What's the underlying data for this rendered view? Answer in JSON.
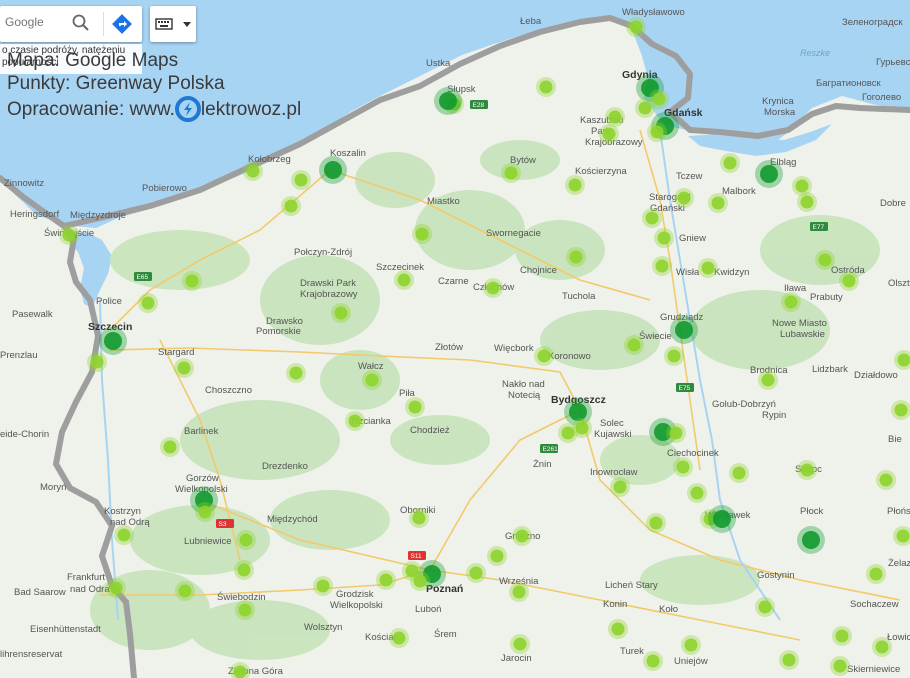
{
  "search": {
    "placeholder": "Google"
  },
  "traffic_note": "o czasie podróży, natężeniu popularności",
  "caption": {
    "line1": "Mapa: Google Maps",
    "line2": "Punkty: Greenway Polska",
    "line3_prefix": "Opracowanie: www.",
    "line3_suffix": "lektrowoz.pl"
  },
  "colors": {
    "sea": "#a8d4f4",
    "land": "#eef2ea",
    "forest": "#c8e4bc",
    "border": "#9e9e9e",
    "point_light": "#8ed42e",
    "point_dark": "#119a2e",
    "logo": "#1f78d1"
  },
  "water_labels": [
    {
      "id": "reszke",
      "text": "Reszke"
    }
  ],
  "roads": [
    {
      "id": "e28",
      "text": "E28"
    },
    {
      "id": "e65",
      "text": "E65"
    },
    {
      "id": "e261",
      "text": "E261"
    },
    {
      "id": "e75",
      "text": "E75"
    },
    {
      "id": "s11",
      "text": "S11"
    },
    {
      "id": "s3",
      "text": "S3"
    },
    {
      "id": "e77",
      "text": "E77"
    }
  ],
  "cities": [
    {
      "id": "ustka",
      "text": "Ustka"
    },
    {
      "id": "leba",
      "text": "Łeba"
    },
    {
      "id": "wladyslawowo",
      "text": "Władysławowo"
    },
    {
      "id": "slupsk",
      "text": "Słupsk"
    },
    {
      "id": "gdynia",
      "text": "Gdynia"
    },
    {
      "id": "gdansk",
      "text": "Gdańsk"
    },
    {
      "id": "koszalin",
      "text": "Koszalin"
    },
    {
      "id": "kolobrzeg",
      "text": "Kołobrzeg"
    },
    {
      "id": "bytow",
      "text": "Bytów"
    },
    {
      "id": "koscierzyna",
      "text": "Kościerzyna"
    },
    {
      "id": "kaszubski",
      "text": "Kaszubski"
    },
    {
      "id": "park",
      "text": "Park"
    },
    {
      "id": "krajobrazowy",
      "text": "Krajobrazowy"
    },
    {
      "id": "elblag",
      "text": "Elbląg"
    },
    {
      "id": "tczew",
      "text": "Tczew"
    },
    {
      "id": "malbork",
      "text": "Malbork"
    },
    {
      "id": "starogard",
      "text": "Starogard"
    },
    {
      "id": "gdanski",
      "text": "Gdański"
    },
    {
      "id": "miastko",
      "text": "Miastko"
    },
    {
      "id": "swiecie",
      "text": "Świecie"
    },
    {
      "id": "swornegacie",
      "text": "Swornegacie"
    },
    {
      "id": "chojnice",
      "text": "Chojnice"
    },
    {
      "id": "czluchow",
      "text": "Człuchów"
    },
    {
      "id": "tuchola",
      "text": "Tuchola"
    },
    {
      "id": "szczecinek",
      "text": "Szczecinek"
    },
    {
      "id": "czarne",
      "text": "Czarne"
    },
    {
      "id": "polczyn",
      "text": "Połczyn-Zdrój"
    },
    {
      "id": "drawski_park",
      "text": "Drawski Park"
    },
    {
      "id": "drawski_kraj",
      "text": "Krajobrazowy"
    },
    {
      "id": "drawsko",
      "text": "Drawsko"
    },
    {
      "id": "pomorskie",
      "text": "Pomorskie"
    },
    {
      "id": "szczecin",
      "text": "Szczecin"
    },
    {
      "id": "police",
      "text": "Police"
    },
    {
      "id": "swinoujscie",
      "text": "Świnoujście"
    },
    {
      "id": "miedzyzdroje",
      "text": "Międzyzdroje"
    },
    {
      "id": "pasewalk",
      "text": "Pasewalk"
    },
    {
      "id": "prenzlau",
      "text": "Prenzlau"
    },
    {
      "id": "stargard",
      "text": "Stargard"
    },
    {
      "id": "choszczno",
      "text": "Choszczno"
    },
    {
      "id": "walcz",
      "text": "Wałcz"
    },
    {
      "id": "zlotow",
      "text": "Złotów"
    },
    {
      "id": "wiecbork",
      "text": "Więcbork"
    },
    {
      "id": "koronowo",
      "text": "Koronowo"
    },
    {
      "id": "naklo",
      "text": "Nakło nad"
    },
    {
      "id": "notecia",
      "text": "Notecią"
    },
    {
      "id": "bydgoszcz",
      "text": "Bydgoszcz"
    },
    {
      "id": "solec",
      "text": "Solec"
    },
    {
      "id": "kujawski",
      "text": "Kujawski"
    },
    {
      "id": "pila",
      "text": "Piła"
    },
    {
      "id": "trzcianka",
      "text": "Trzcianka"
    },
    {
      "id": "chodziez",
      "text": "Chodzież"
    },
    {
      "id": "barlinek",
      "text": "Barlinek"
    },
    {
      "id": "gorzow",
      "text": "Gorzów"
    },
    {
      "id": "wielkopolski",
      "text": "Wielkopolski"
    },
    {
      "id": "drezdenko",
      "text": "Drezdenko"
    },
    {
      "id": "znin",
      "text": "Żnin"
    },
    {
      "id": "inowroclaw",
      "text": "Inowrocław"
    },
    {
      "id": "ciechocinek",
      "text": "Ciechocinek"
    },
    {
      "id": "wloclawek",
      "text": "Włocławek"
    },
    {
      "id": "kostrzyn",
      "text": "Kostrzyn"
    },
    {
      "id": "nad_odra",
      "text": "nad Odrą"
    },
    {
      "id": "lubniewice",
      "text": "Lubniewice"
    },
    {
      "id": "miedzychod",
      "text": "Międzychód"
    },
    {
      "id": "oborniki",
      "text": "Oborniki"
    },
    {
      "id": "gniezno",
      "text": "Gniezno"
    },
    {
      "id": "wrzesnia",
      "text": "Września"
    },
    {
      "id": "lichen",
      "text": "Licheń Stary"
    },
    {
      "id": "konin",
      "text": "Konin"
    },
    {
      "id": "kolo",
      "text": "Koło"
    },
    {
      "id": "frankfurt",
      "text": "Frankfurt"
    },
    {
      "id": "nad_odra2",
      "text": "nad Odra"
    },
    {
      "id": "bad_saarow",
      "text": "Bad Saarow"
    },
    {
      "id": "swiebodzin",
      "text": "Świebodzin"
    },
    {
      "id": "grodzisk",
      "text": "Grodzisk"
    },
    {
      "id": "wlkp",
      "text": "Wielkopolski"
    },
    {
      "id": "eisenhuttenstadt",
      "text": "Eisenhüttenstadt"
    },
    {
      "id": "wolsztyn",
      "text": "Wolsztyn"
    },
    {
      "id": "koscian",
      "text": "Kościan"
    },
    {
      "id": "srem",
      "text": "Śrem"
    },
    {
      "id": "jarocin",
      "text": "Jarocin"
    },
    {
      "id": "turek",
      "text": "Turek"
    },
    {
      "id": "uniejow",
      "text": "Uniejów"
    },
    {
      "id": "zielona_gora",
      "text": "Zielona Góra"
    },
    {
      "id": "gostynin",
      "text": "Gostynin"
    },
    {
      "id": "sochaczew",
      "text": "Sochaczew"
    },
    {
      "id": "skierniewice",
      "text": "Skierniewice"
    },
    {
      "id": "plock",
      "text": "Płock"
    },
    {
      "id": "sierpc",
      "text": "Sierpc"
    },
    {
      "id": "rypin",
      "text": "Rypin"
    },
    {
      "id": "golub",
      "text": "Golub-Dobrzyń"
    },
    {
      "id": "brodnica",
      "text": "Brodnica"
    },
    {
      "id": "lidzbark",
      "text": "Lidzbark"
    },
    {
      "id": "dzialdowo",
      "text": "Działdowo"
    },
    {
      "id": "nowe_miasto",
      "text": "Nowe Miasto"
    },
    {
      "id": "lubawskie",
      "text": "Lubawskie"
    },
    {
      "id": "ilawa",
      "text": "Iława"
    },
    {
      "id": "ostroda",
      "text": "Ostróda"
    },
    {
      "id": "kwidzyn",
      "text": "Kwidzyn"
    },
    {
      "id": "grudziadz",
      "text": "Grudziądz"
    },
    {
      "id": "gniew",
      "text": "Gniew"
    },
    {
      "id": "krynica",
      "text": "Krynica"
    },
    {
      "id": "morska",
      "text": "Morska"
    },
    {
      "id": "zinnowitz",
      "text": "Zinnowitz"
    },
    {
      "id": "heringsdorf",
      "text": "Heringsdorf"
    },
    {
      "id": "pobierowo",
      "text": "Pobierowo"
    },
    {
      "id": "chorin",
      "text": "eide-Chorin"
    },
    {
      "id": "lihrensreservat",
      "text": "lihrensreservat"
    },
    {
      "id": "zelenogradsk",
      "text": "Зеленоградск"
    },
    {
      "id": "gurjevsk",
      "text": "Гурьевск"
    },
    {
      "id": "bagrationovsk",
      "text": "Багратионовск"
    },
    {
      "id": "gogolevo",
      "text": "Гоголево"
    },
    {
      "id": "dobre_miasto",
      "text": "Dobre"
    },
    {
      "id": "olsztynek",
      "text": "Olsztynek"
    },
    {
      "id": "plonsk",
      "text": "Płońs"
    },
    {
      "id": "lowicz",
      "text": "Łowicz"
    },
    {
      "id": "zelazna",
      "text": "Żelazny"
    },
    {
      "id": "sierpc2",
      "text": "Bie"
    },
    {
      "id": "poznan",
      "text": "Poznań"
    },
    {
      "id": "lubon",
      "text": "Luboń"
    },
    {
      "id": "moryn",
      "text": "Moryń"
    },
    {
      "id": "prabuty",
      "text": "Prabuty"
    },
    {
      "id": "wisla",
      "text": "Wisła"
    }
  ]
}
